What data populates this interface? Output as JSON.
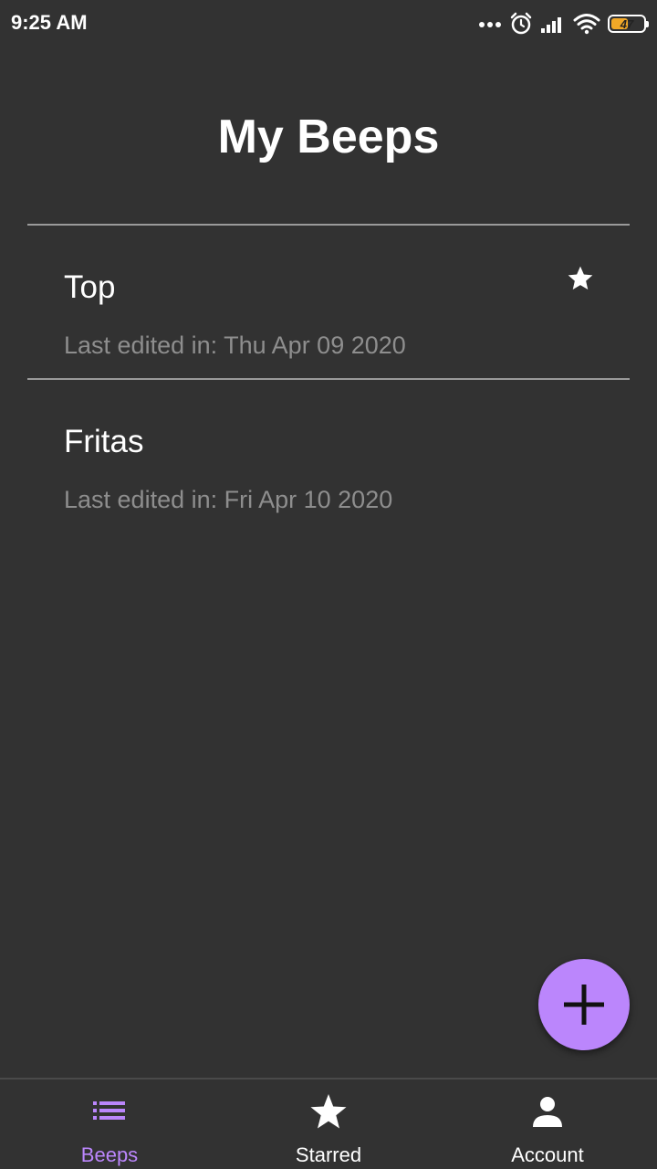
{
  "status_bar": {
    "time": "9:25 AM",
    "battery_level": "47",
    "icons": [
      "dots-icon",
      "alarm-icon",
      "signal-icon",
      "wifi-icon",
      "battery-icon"
    ]
  },
  "page": {
    "title": "My Beeps"
  },
  "beeps": [
    {
      "title": "Top",
      "subtitle": "Last edited in: Thu Apr 09 2020",
      "starred": true
    },
    {
      "title": "Fritas",
      "subtitle": "Last edited in: Fri Apr 10 2020",
      "starred": false
    }
  ],
  "fab": {
    "icon": "plus-icon"
  },
  "bottom_nav": {
    "items": [
      {
        "label": "Beeps",
        "icon": "list-icon",
        "active": true
      },
      {
        "label": "Starred",
        "icon": "star-icon",
        "active": false
      },
      {
        "label": "Account",
        "icon": "person-icon",
        "active": false
      }
    ]
  },
  "colors": {
    "background": "#323232",
    "accent": "#bb86fc",
    "secondary_text": "#8e8e8e",
    "divider": "#9a9a9a",
    "battery": "#f1a827"
  }
}
